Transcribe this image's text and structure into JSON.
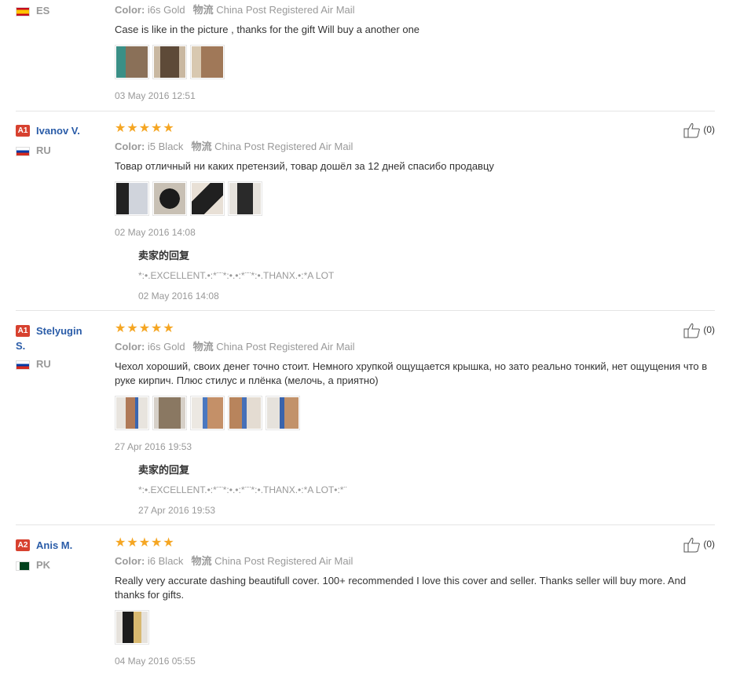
{
  "reviews": [
    {
      "country": "ES",
      "color_label": "Color:",
      "color_value": "i6s Gold",
      "shipping_label": "物流",
      "shipping_value": "China Post Registered Air Mail",
      "text": "Case is like in the picture , thanks for the gift Will buy a another one",
      "images": [
        "teal-case",
        "brown-case",
        "gold-case"
      ],
      "date": "03 May 2016 12:51"
    },
    {
      "badge": "A1",
      "name": "Ivanov V.",
      "country": "RU",
      "stars": "★★★★★",
      "color_label": "Color:",
      "color_value": "i5 Black",
      "shipping_label": "物流",
      "shipping_value": "China Post Registered Air Mail",
      "text": "Товар отличный ни каких претензий, товар дошёл за 12 дней спасибо продавцу",
      "images": [
        "black-case-1",
        "black-case-2",
        "black-case-3",
        "black-case-4"
      ],
      "date": "02 May 2016 14:08",
      "reply_title": "卖家的回复",
      "reply_text": "*:•.EXCELLENT.•:*¨¨*:•.•:*¨¨*:•.THANX.•:*A LOT",
      "reply_date": "02 May 2016 14:08",
      "likes": "(0)"
    },
    {
      "badge": "A1",
      "name": "Stelyugin",
      "name_line2": "S.",
      "country": "RU",
      "stars": "★★★★★",
      "color_label": "Color:",
      "color_value": "i6s Gold",
      "shipping_label": "物流",
      "shipping_value": "China Post Registered Air Mail",
      "text": "Чехол хороший, своих денег точно стоит. Немного хрупкой ощущается крышка, но зато реально тонкий, нет ощущения что в руке кирпич. Плюс стилус и плёнка (мелочь, а приятно)",
      "images": [
        "gold-case-1",
        "gold-case-2",
        "gold-case-3",
        "gold-case-4",
        "gold-case-5"
      ],
      "date": "27 Apr 2016 19:53",
      "reply_title": "卖家的回复",
      "reply_text": "*:•.EXCELLENT.•:*¨¨*:•.•:*¨¨*:•.THANX.•:*A LOT•:*¨",
      "reply_date": "27 Apr 2016 19:53",
      "likes": "(0)"
    },
    {
      "badge": "A2",
      "name": "Anis M.",
      "country": "PK",
      "stars": "★★★★★",
      "color_label": "Color:",
      "color_value": "i6 Black",
      "shipping_label": "物流",
      "shipping_value": "China Post Registered Air Mail",
      "text": "Really very accurate dashing beautifull cover. 100+ recommended I love this cover and seller. Thanks seller will buy more. And thanks for gifts.",
      "images": [
        "black-gold-case"
      ],
      "date": "04 May 2016 05:55",
      "likes": "(0)"
    }
  ],
  "colors": {
    "star": "#f5a623",
    "name": "#2a5ca8",
    "badge": "#d7412f"
  },
  "icons": {
    "like": "thumbs-up-icon"
  }
}
